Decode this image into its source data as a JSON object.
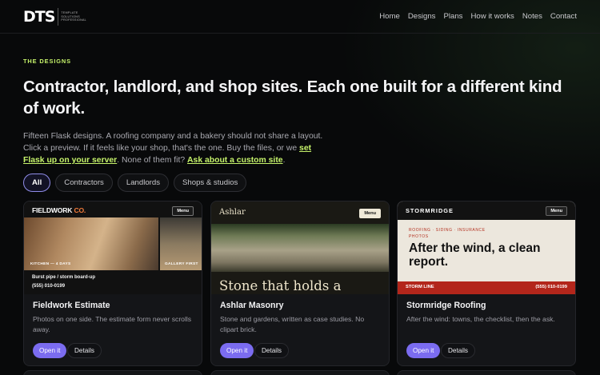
{
  "header": {
    "logo": {
      "mark": "DTS",
      "lines": [
        "TEMPLATE",
        "SOLUTIONS",
        "PROFESSIONAL"
      ]
    },
    "nav": [
      "Home",
      "Designs",
      "Plans",
      "How it works",
      "Notes",
      "Contact"
    ]
  },
  "hero": {
    "eyebrow": "THE DESIGNS",
    "headline": "Contractor, landlord, and shop sites. Each one built for a different kind of work.",
    "lede": {
      "part1": "Fifteen Flask designs. A roofing company and a bakery should not share a layout. Click a preview. If it feels like your shop, that's the one. Buy the files, or we ",
      "link1": "set Flask up on your server",
      "part2": ". None of them fit? ",
      "link2": "Ask about a custom site",
      "part3": "."
    }
  },
  "filters": [
    "All",
    "Contractors",
    "Landlords",
    "Shops & studios"
  ],
  "cards": [
    {
      "title": "Fieldwork Estimate",
      "desc": "Photos on one side. The estimate form never scrolls away.",
      "open": "Open it",
      "details": "Details",
      "preview": {
        "brand_a": "FIELDWORK",
        "brand_b": "CO.",
        "menu": "Menu",
        "cap_left": "KITCHEN — 4 DAYS",
        "cap_right": "GALLERY FIRST",
        "line1": "Burst pipe / storm board-up",
        "line2": "(555) 010-0199"
      }
    },
    {
      "title": "Ashlar Masonry",
      "desc": "Stone and gardens, written as case studies. No clipart brick.",
      "open": "Open it",
      "details": "Details",
      "preview": {
        "brand": "Ashlar",
        "menu": "Menu",
        "headline": "Stone that holds a"
      }
    },
    {
      "title": "Stormridge Roofing",
      "desc": "After the wind: towns, the checklist, then the ask.",
      "open": "Open it",
      "details": "Details",
      "preview": {
        "brand": "STORMRIDGE",
        "menu": "Menu",
        "kicker": "ROOFING · SIDING · INSURANCE PHOTOS",
        "headline": "After the wind, a clean report.",
        "bar_left": "STORM LINE",
        "bar_right": "(555) 010-0199"
      }
    }
  ],
  "colors": {
    "accent_lime": "#c6f36b",
    "accent_purple": "#7b6cf0",
    "storm_red": "#b3261b"
  }
}
